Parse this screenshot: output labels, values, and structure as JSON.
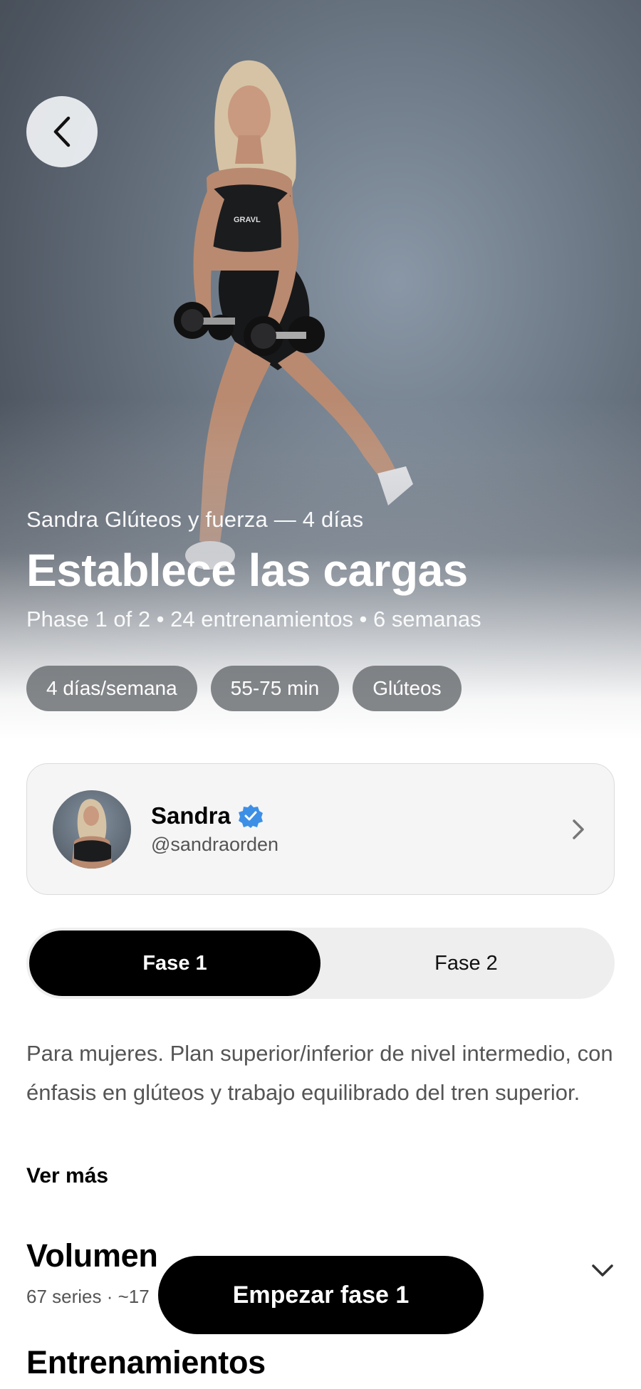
{
  "hero": {
    "program_name": "Sandra Glúteos y fuerza — 4 días",
    "phase_title": "Establece las cargas",
    "phase_meta": "Phase 1 of 2 • 24 entrenamientos • 6 semanas",
    "tags": [
      "4 días/semana",
      "55-75 min",
      "Glúteos"
    ],
    "back_icon": "chevron-left-icon",
    "top_logo_text": "GRAVL"
  },
  "coach": {
    "name": "Sandra",
    "handle": "@sandraorden",
    "verified_icon": "verified-badge-icon",
    "verified_color": "#3d8fe6"
  },
  "phases": {
    "tabs": [
      "Fase 1",
      "Fase 2"
    ],
    "selected": "Fase 1"
  },
  "description": {
    "text": "Para mujeres. Plan superior/inferior de nivel intermedio, con énfasis en glúteos y trabajo equilibrado del tren superior.",
    "see_more": "Ver más"
  },
  "volume": {
    "title": "Volumen",
    "subtitle": "67 series · ~17"
  },
  "workouts": {
    "title": "Entrenamientos"
  },
  "cta": {
    "label": "Empezar fase 1"
  }
}
